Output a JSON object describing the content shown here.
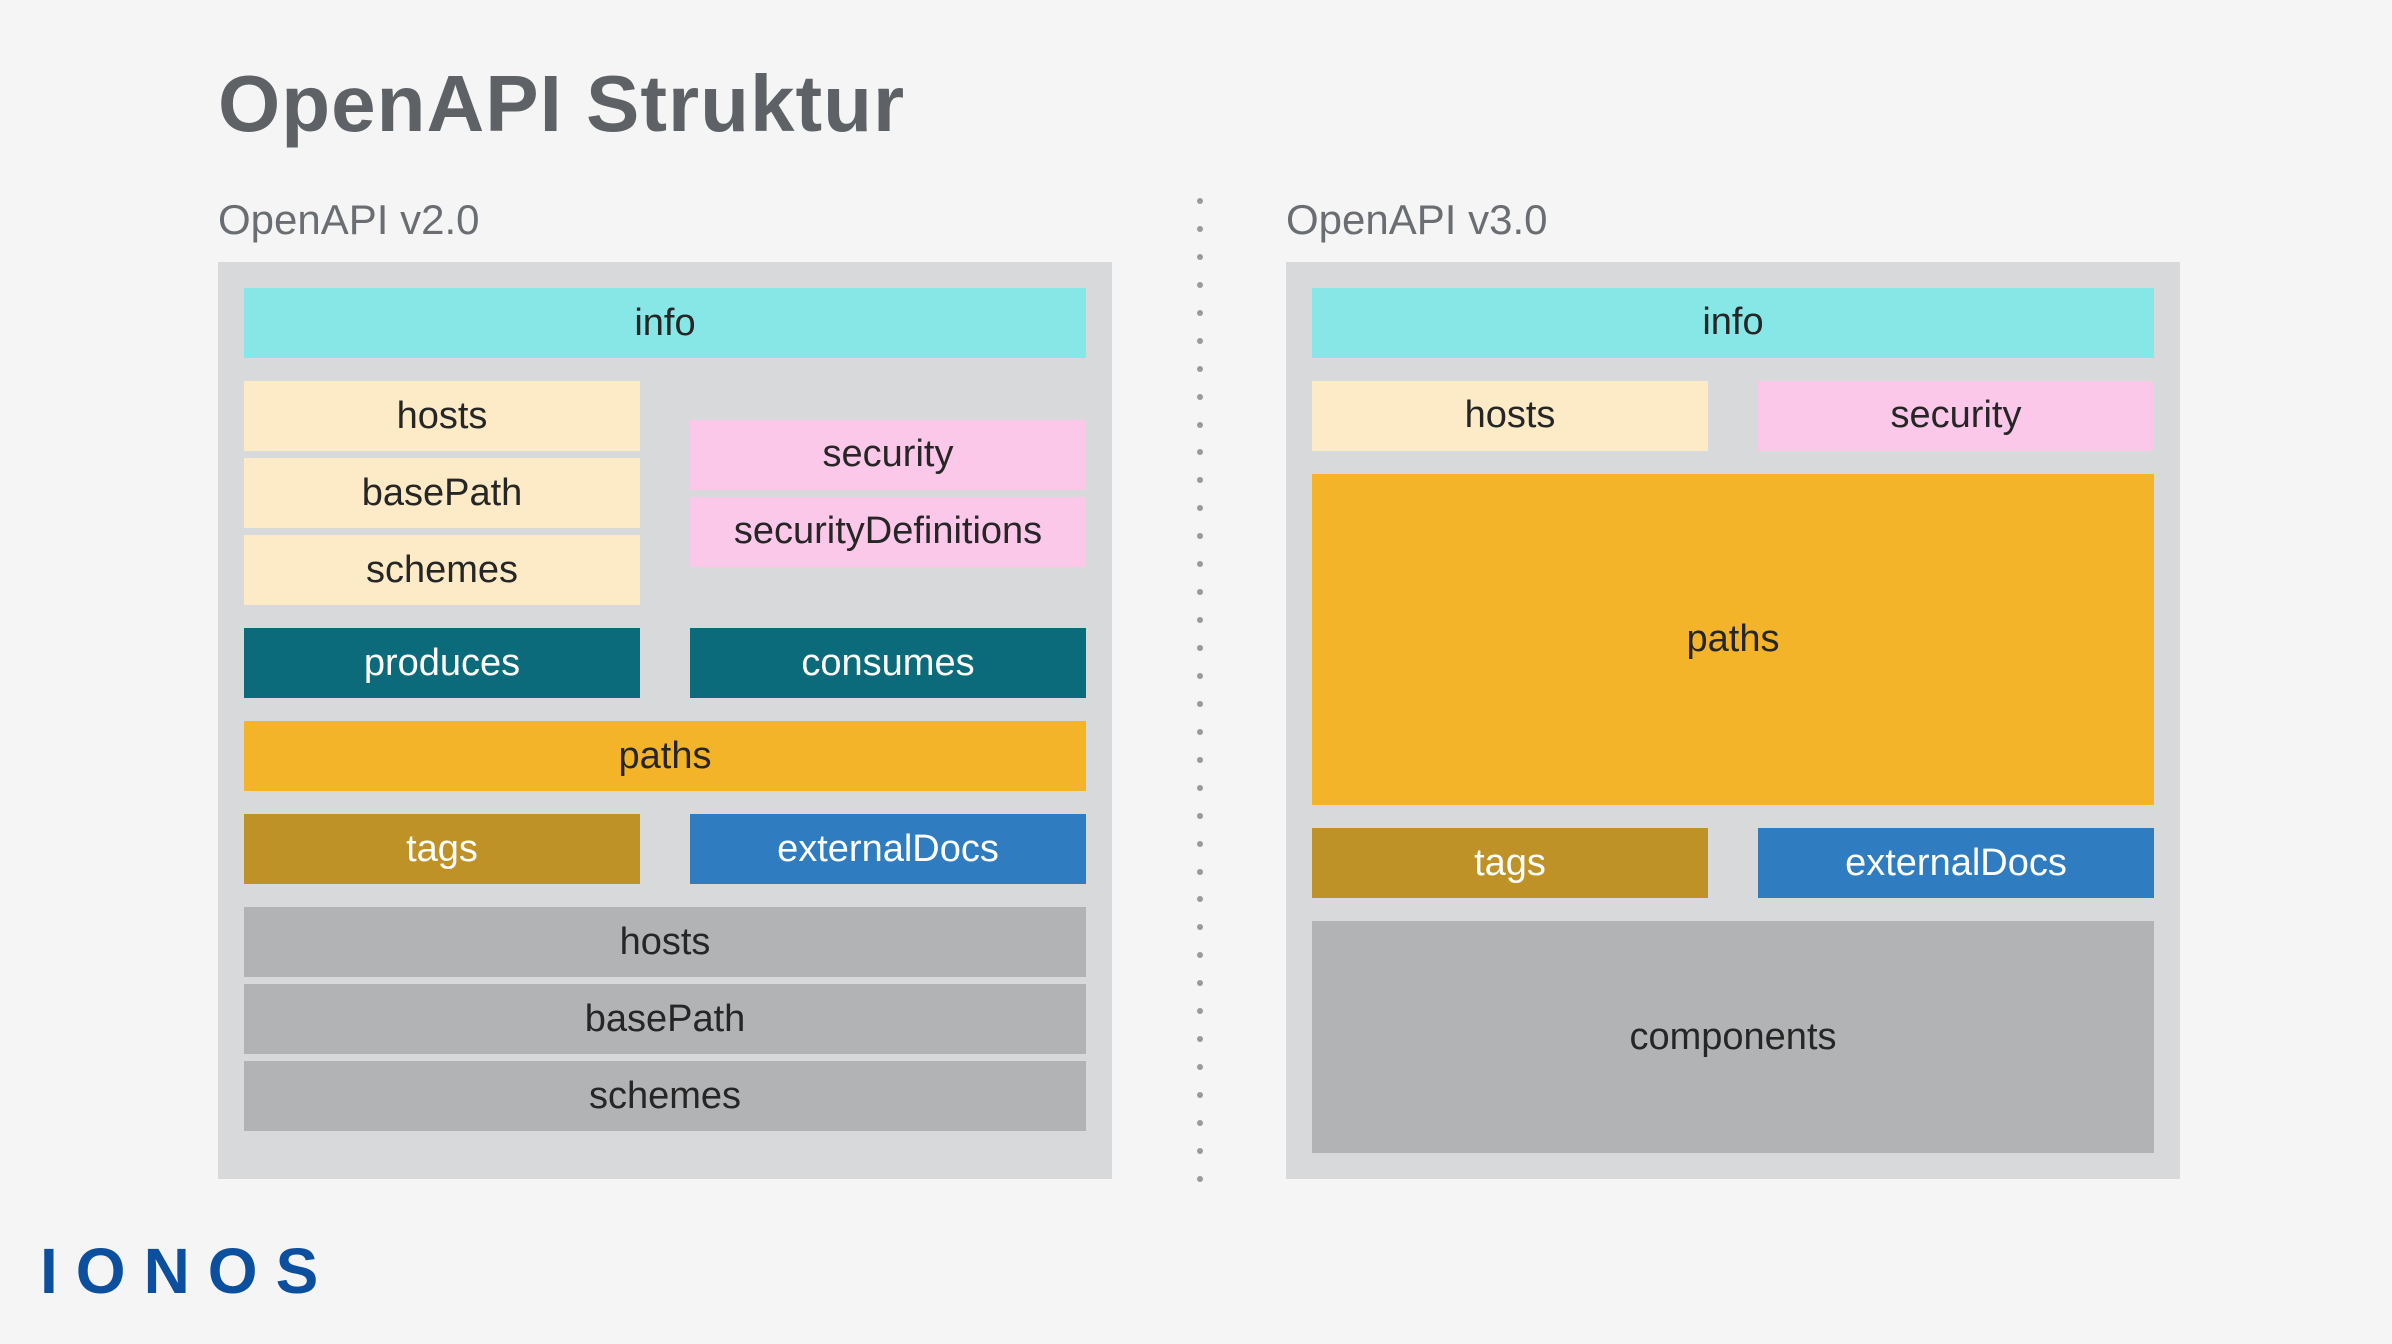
{
  "title": "OpenAPI Struktur",
  "left": {
    "heading": "OpenAPI v2.0",
    "info": "info",
    "hosts": "hosts",
    "basePath": "basePath",
    "schemes": "schemes",
    "security": "security",
    "securityDefinitions": "securityDefinitions",
    "produces": "produces",
    "consumes": "consumes",
    "paths": "paths",
    "tags": "tags",
    "externalDocs": "externalDocs",
    "grayHosts": "hosts",
    "grayBasePath": "basePath",
    "graySchemes": "schemes"
  },
  "right": {
    "heading": "OpenAPI v3.0",
    "info": "info",
    "hosts": "hosts",
    "security": "security",
    "paths": "paths",
    "tags": "tags",
    "externalDocs": "externalDocs",
    "components": "components"
  },
  "logo": "IONOS",
  "colors": {
    "info": "#87e7e7",
    "cream": "#fdebc7",
    "pink": "#fcc8ea",
    "teal": "#0c6b7a",
    "orange": "#f3b429",
    "olive": "#bf9228",
    "blue": "#2f7cc0",
    "gray": "#b2b3b5",
    "panel": "#d8d9da",
    "bg": "#f5f5f5",
    "logo": "#0b4f9e"
  }
}
